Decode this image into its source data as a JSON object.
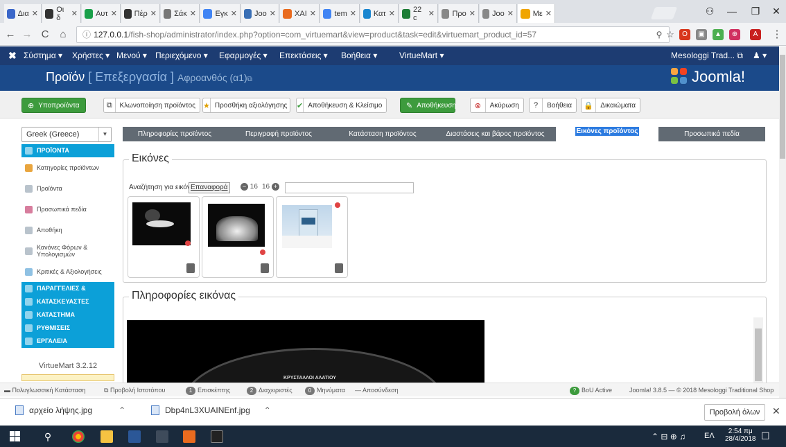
{
  "browser": {
    "tabs": [
      {
        "title": "Δια",
        "color": "#3b67c9"
      },
      {
        "title": "Οι δ",
        "color": "#333333"
      },
      {
        "title": "Αυτ",
        "color": "#1aa04a"
      },
      {
        "title": "Πέρ",
        "color": "#333333"
      },
      {
        "title": "Σάκ",
        "color": "#777777"
      },
      {
        "title": "Εγκ",
        "color": "#4285f4"
      },
      {
        "title": "Joo",
        "color": "#3a6fb5"
      },
      {
        "title": "ΧΑΙ",
        "color": "#e96b1f"
      },
      {
        "title": "tem",
        "color": "#4285f4"
      },
      {
        "title": "Κατ",
        "color": "#1a86d0"
      },
      {
        "title": "22 c",
        "color": "#1e7d37"
      },
      {
        "title": "Προ",
        "color": "#888888"
      },
      {
        "title": "Joo",
        "color": "#888888"
      },
      {
        "title": "Με",
        "color": "#f0a500"
      }
    ],
    "address": {
      "host": "127.0.0.1",
      "path": "/fish-shop/administrator/index.php?option=com_virtuemart&view=product&task=edit&virtuemart_product_id=57"
    }
  },
  "jnav": {
    "items": [
      "Σύστημα ▾",
      "Χρήστες ▾",
      "Μενού ▾",
      "Περιεχόμενο ▾",
      "Εφαρμογές ▾",
      "Επεκτάσεις ▾",
      "Βοήθεια ▾",
      "VirtueMart ▾"
    ],
    "user": "Mesologgi Trad... ⧉"
  },
  "header": {
    "title_main": "Προϊόν",
    "title_sub": "[ Επεξεργασία ]",
    "title_small": "Αφροανθός (α1)",
    "logo_text": "Joomla!"
  },
  "toolbar": {
    "products": "Υποπροϊόντα",
    "clone": "Κλωνοποίηση προϊόντος",
    "add_review": "Προσθήκη αξιολόγησης",
    "save_close": "Αποθήκευση & Κλείσιμο",
    "save": "Αποθήκευση",
    "cancel": "Ακύρωση",
    "help": "Βοήθεια",
    "permissions": "Δικαιώματα"
  },
  "sidebar": {
    "language": "Greek (Greece)",
    "header_products": "ΠΡΟΪΟΝΤΑ",
    "items": [
      "Κατηγορίες προϊόντων",
      "Προϊόντα",
      "Προσωπικά πεδία",
      "Αποθήκη",
      "Κανόνες Φόρων & Υπολογισμών",
      "Κριτικές & Αξιολογήσεις"
    ],
    "groups": [
      "ΠΑΡΑΓΓΕΛΙΕΣ & ΠΕΛΑΤΕΣ",
      "ΚΑΤΑΣΚΕΥΑΣΤΕΣ",
      "ΚΑΤΑΣΤΗΜΑ",
      "ΡΥΘΜΙΣΕΙΣ",
      "ΕΡΓΑΛΕΙΑ"
    ],
    "version": "VirtueMart 3.2.12"
  },
  "tabs": [
    "Πληροφορίες προϊόντος",
    "Περιγραφή προϊόντος",
    "Κατάσταση προϊόντος",
    "Διαστάσεις και βάρος προϊόντος",
    "Εικόνες προϊόντος",
    "Προσωπικά πεδία"
  ],
  "images": {
    "legend": "Εικόνες",
    "search_label": "Αναζήτηση για εικόνες",
    "reset_button": "Επαναφορά",
    "page_prev": "16",
    "page_next": "16",
    "info_legend": "Πληροφορίες εικόνας",
    "preview_caption": "ΚΡΥΣΤΑΛΛΟΙ ΑΛΑΤΙΟΥ"
  },
  "statusbar": {
    "multilang": "Πολυγλωσσική Κατάσταση",
    "view_site": "Προβολή Ιστοτόπου",
    "visitors_count": "1",
    "visitors": "Επισκέπτης",
    "admins_count": "2",
    "admins": "Διαχειριστές",
    "messages_count": "0",
    "messages": "Μηνύματα",
    "logout": "Αποσύνδεση",
    "bou": "BoU Active",
    "footer": "Joomla! 3.8.5 — © 2018 Mesologgi Traditional Shop"
  },
  "downloads": {
    "file1": "αρχείο λήψης.jpg",
    "file2": "Dbp4nL3XUAINEnf.jpg",
    "show_all": "Προβολή όλων"
  },
  "taskbar": {
    "lang": "ΕΛ",
    "time": "2:54 πμ",
    "date": "28/4/2018"
  }
}
